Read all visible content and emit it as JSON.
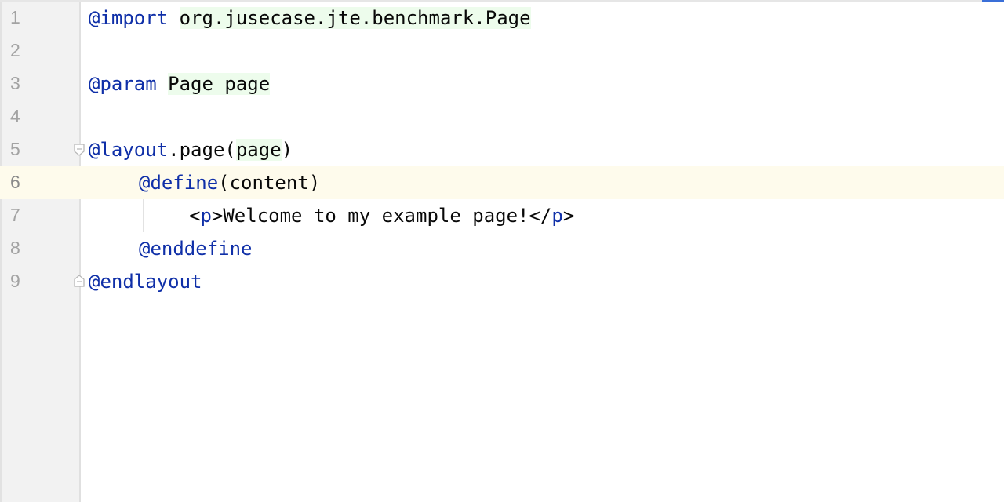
{
  "editor": {
    "lines": [
      {
        "number": "1",
        "tokens": [
          "@import",
          " ",
          "org.jusecase.jte.benchmark.Page"
        ]
      },
      {
        "number": "2",
        "tokens": []
      },
      {
        "number": "3",
        "tokens": [
          "@param",
          " ",
          "Page page"
        ]
      },
      {
        "number": "4",
        "tokens": []
      },
      {
        "number": "5",
        "tokens": [
          "@layout",
          ".page(",
          "page",
          ")"
        ]
      },
      {
        "number": "6",
        "tokens": [
          "@define",
          "(content)"
        ]
      },
      {
        "number": "7",
        "tokens": [
          "<",
          "p",
          ">Welcome to my example page!</",
          "p",
          ">"
        ]
      },
      {
        "number": "8",
        "tokens": [
          "@enddefine"
        ]
      },
      {
        "number": "9",
        "tokens": [
          "@endlayout"
        ]
      }
    ],
    "current_line": "6"
  },
  "colors": {
    "keyword": "#0f2fa8",
    "text": "#080808",
    "line_number": "#a3a3a3",
    "current_line_bg": "#fefbec",
    "highlight_bg": "#edfcec",
    "gutter_bg": "#f2f2f2",
    "accent": "#3a6fd8"
  },
  "icons": {
    "fold_start": "fold-collapse-icon",
    "fold_end": "fold-end-icon"
  }
}
